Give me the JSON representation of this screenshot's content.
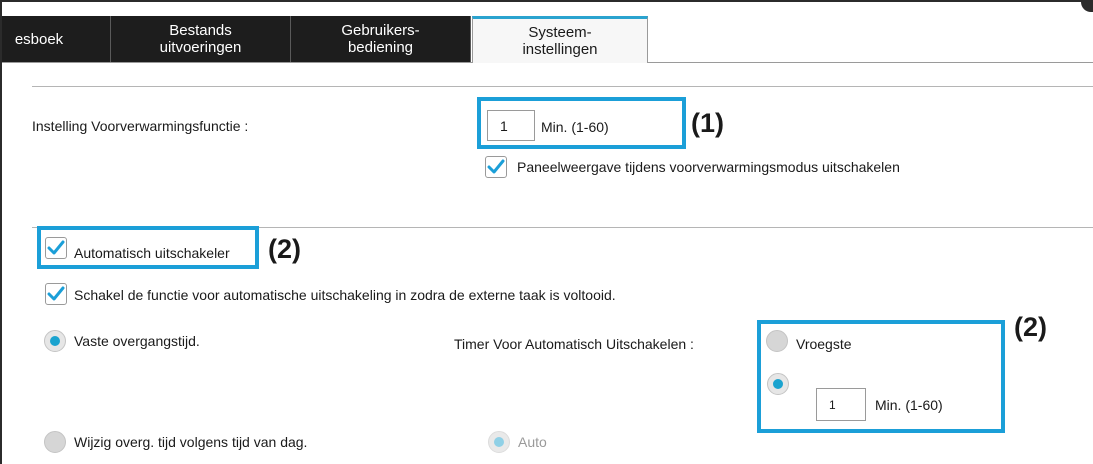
{
  "tabs": [
    {
      "label": "esboek"
    },
    {
      "label": "Bestands\nuitvoeringen"
    },
    {
      "label": "Gebruikers-\nbediening"
    },
    {
      "label": "Systeem-\ninstellingen"
    }
  ],
  "preheat": {
    "label": "Instelling Voorverwarmingsfunctie :",
    "value": "1",
    "unit": "Min. (1-60)",
    "callout": "(1)",
    "panel_checkbox_label": "Paneelweergave tijdens voorverwarmingsmodus uitschakelen",
    "panel_checkbox_checked": true
  },
  "auto_off": {
    "checkbox_label": "Automatisch uitschakeler",
    "checkbox_checked": true,
    "callout": "(2)",
    "external_checkbox_label": "Schakel de functie voor automatische uitschakeling in zodra de externe taak is voltooid.",
    "external_checkbox_checked": true,
    "fixed_radio_label": "Vaste overgangstijd.",
    "fixed_radio_selected": true,
    "timer_label": "Timer Voor Automatisch Uitschakelen :",
    "timer_callout": "(2)",
    "earliest_label": "Vroegste",
    "custom_value": "1",
    "custom_unit": "Min.  (1-60)",
    "tod_radio_label": "Wijzig overg. tijd volgens tijd van dag.",
    "auto_label": "Auto"
  },
  "colors": {
    "accent": "#1b9fd8",
    "tab_dark": "#1d1d1d",
    "radio_on": "#1aa3cf"
  }
}
